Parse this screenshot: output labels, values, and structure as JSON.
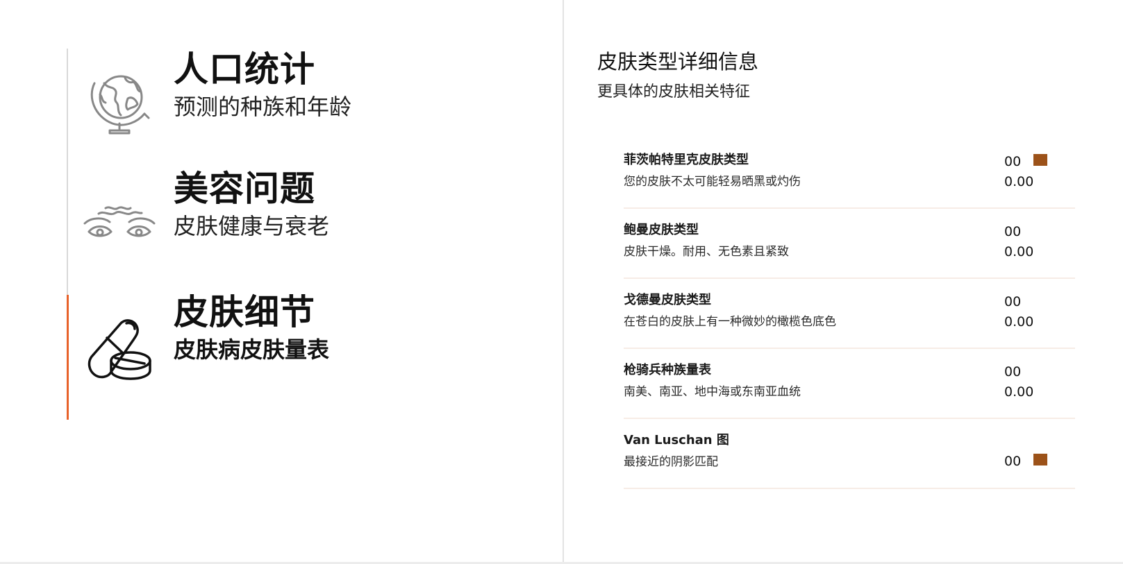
{
  "nav": {
    "items": [
      {
        "title": "人口统计",
        "subtitle": "预测的种族和年龄",
        "icon": "globe-icon",
        "active": false
      },
      {
        "title": "美容问题",
        "subtitle": "皮肤健康与衰老",
        "icon": "eyes-wrinkles-icon",
        "active": false
      },
      {
        "title": "皮肤细节",
        "subtitle": "皮肤病皮肤量表",
        "icon": "pills-icon",
        "active": true
      }
    ],
    "active_color": "#e8622a"
  },
  "details": {
    "title": "皮肤类型详细信息",
    "subtitle": "更具体的皮肤相关特征",
    "rows": [
      {
        "name": "菲茨帕特里克皮肤类型",
        "desc": "您的皮肤不太可能轻易晒黑或灼伤",
        "code": "00",
        "score": "0.00",
        "swatch": "#9c5219"
      },
      {
        "name": "鲍曼皮肤类型",
        "desc": "皮肤干燥。耐用、无色素且紧致",
        "code": "00",
        "score": "0.00",
        "swatch": null
      },
      {
        "name": "戈德曼皮肤类型",
        "desc": "在苍白的皮肤上有一种微妙的橄榄色底色",
        "code": "00",
        "score": "0.00",
        "swatch": null
      },
      {
        "name": "枪骑兵种族量表",
        "desc": "南美、南亚、地中海或东南亚血统",
        "code": "00",
        "score": "0.00",
        "swatch": null
      },
      {
        "name": "Van Luschan 图",
        "desc": "最接近的阴影匹配",
        "code": "00",
        "score": null,
        "swatch": "#9c5219"
      }
    ]
  }
}
